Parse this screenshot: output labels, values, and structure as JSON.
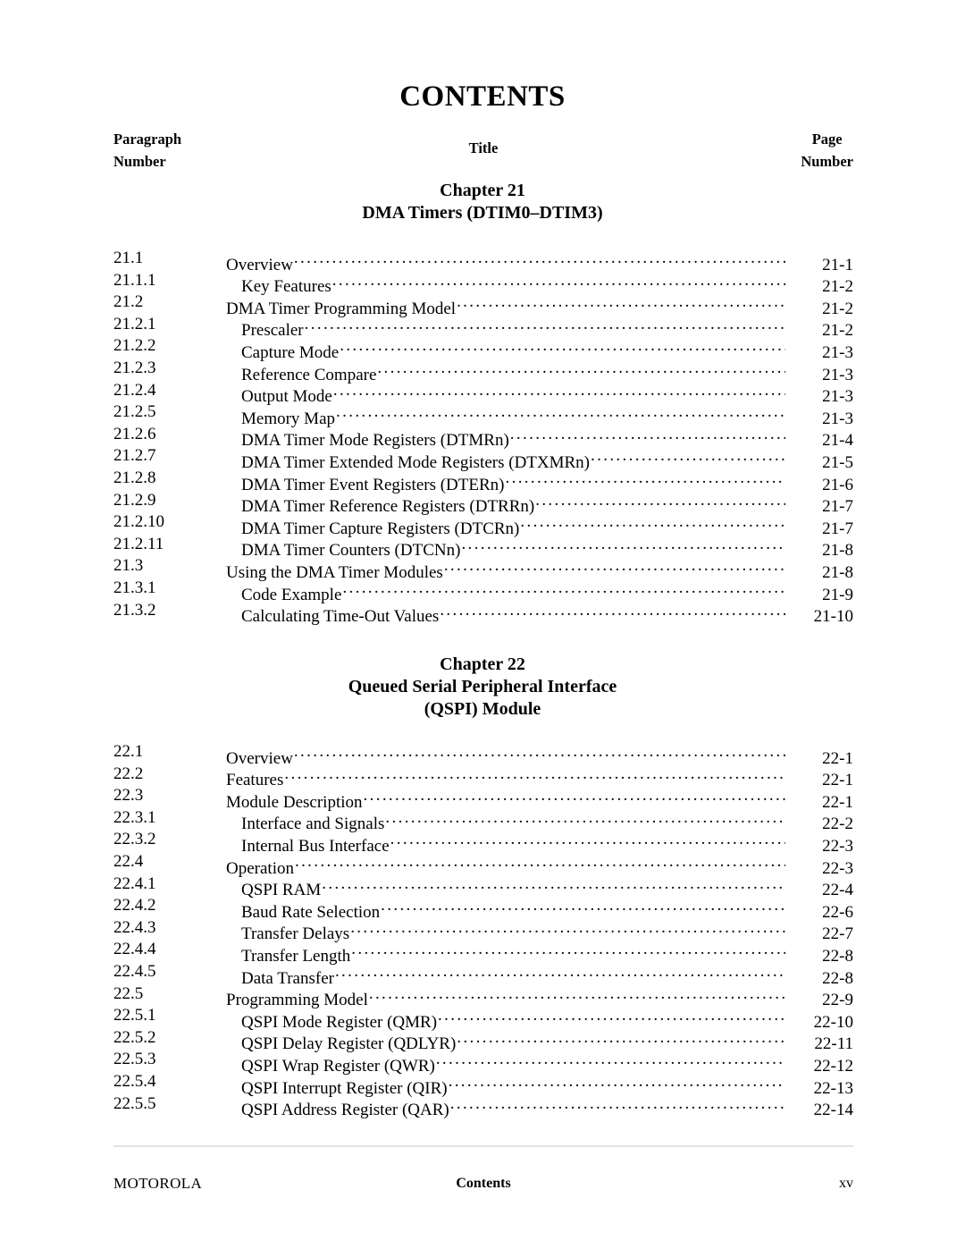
{
  "page": {
    "title": "CONTENTS",
    "headers": {
      "paragraph_line1": "Paragraph",
      "paragraph_line2": "Number",
      "title": "Title",
      "page_line1": "Page",
      "page_line2": "Number"
    }
  },
  "chapters": [
    {
      "heading_lines": [
        "Chapter 21",
        "DMA Timers (DTIM0–DTIM3)"
      ],
      "entries": [
        {
          "number": "21.1",
          "title": "Overview",
          "page": "21-1",
          "level": 1
        },
        {
          "number": "21.1.1",
          "title": "Key Features",
          "page": "21-2",
          "level": 2
        },
        {
          "number": "21.2",
          "title": "DMA Timer Programming Model",
          "page": "21-2",
          "level": 1
        },
        {
          "number": "21.2.1",
          "title": "Prescaler",
          "page": "21-2",
          "level": 2
        },
        {
          "number": "21.2.2",
          "title": "Capture Mode",
          "page": "21-3",
          "level": 2
        },
        {
          "number": "21.2.3",
          "title": "Reference Compare",
          "page": "21-3",
          "level": 2
        },
        {
          "number": "21.2.4",
          "title": "Output Mode",
          "page": "21-3",
          "level": 2
        },
        {
          "number": "21.2.5",
          "title": "Memory Map",
          "page": "21-3",
          "level": 2
        },
        {
          "number": "21.2.6",
          "title": "DMA Timer Mode Registers (DTMRn)",
          "page": "21-4",
          "level": 2
        },
        {
          "number": "21.2.7",
          "title": "DMA Timer Extended Mode Registers (DTXMRn)",
          "page": "21-5",
          "level": 2
        },
        {
          "number": "21.2.8",
          "title": "DMA Timer Event Registers (DTERn)",
          "page": "21-6",
          "level": 2
        },
        {
          "number": "21.2.9",
          "title": "DMA Timer Reference Registers (DTRRn)",
          "page": "21-7",
          "level": 2
        },
        {
          "number": "21.2.10",
          "title": "DMA Timer Capture Registers (DTCRn)",
          "page": "21-7",
          "level": 2
        },
        {
          "number": "21.2.11",
          "title": "DMA Timer Counters (DTCNn)",
          "page": "21-8",
          "level": 2
        },
        {
          "number": "21.3",
          "title": "Using the DMA Timer Modules",
          "page": "21-8",
          "level": 1
        },
        {
          "number": "21.3.1",
          "title": "Code Example",
          "page": "21-9",
          "level": 2
        },
        {
          "number": "21.3.2",
          "title": "Calculating Time-Out Values",
          "page": "21-10",
          "level": 2
        }
      ]
    },
    {
      "heading_lines": [
        "Chapter 22",
        "Queued Serial Peripheral Interface",
        "(QSPI) Module"
      ],
      "entries": [
        {
          "number": "22.1",
          "title": "Overview",
          "page": "22-1",
          "level": 1
        },
        {
          "number": "22.2",
          "title": "Features",
          "page": "22-1",
          "level": 1
        },
        {
          "number": "22.3",
          "title": "Module Description",
          "page": "22-1",
          "level": 1
        },
        {
          "number": "22.3.1",
          "title": "Interface and Signals",
          "page": "22-2",
          "level": 2
        },
        {
          "number": "22.3.2",
          "title": "Internal Bus Interface",
          "page": "22-3",
          "level": 2
        },
        {
          "number": "22.4",
          "title": "Operation",
          "page": "22-3",
          "level": 1
        },
        {
          "number": "22.4.1",
          "title": "QSPI RAM",
          "page": "22-4",
          "level": 2
        },
        {
          "number": "22.4.2",
          "title": "Baud Rate Selection",
          "page": "22-6",
          "level": 2
        },
        {
          "number": "22.4.3",
          "title": "Transfer Delays",
          "page": "22-7",
          "level": 2
        },
        {
          "number": "22.4.4",
          "title": "Transfer Length",
          "page": "22-8",
          "level": 2
        },
        {
          "number": "22.4.5",
          "title": "Data Transfer",
          "page": "22-8",
          "level": 2
        },
        {
          "number": "22.5",
          "title": "Programming Model",
          "page": "22-9",
          "level": 1
        },
        {
          "number": "22.5.1",
          "title": "QSPI Mode Register (QMR)",
          "page": "22-10",
          "level": 2
        },
        {
          "number": "22.5.2",
          "title": "QSPI Delay Register (QDLYR)",
          "page": "22-11",
          "level": 2
        },
        {
          "number": "22.5.3",
          "title": "QSPI Wrap Register (QWR)",
          "page": "22-12",
          "level": 2
        },
        {
          "number": "22.5.4",
          "title": "QSPI Interrupt Register (QIR)",
          "page": "22-13",
          "level": 2
        },
        {
          "number": "22.5.5",
          "title": "QSPI Address Register (QAR)",
          "page": "22-14",
          "level": 2
        }
      ]
    }
  ],
  "footer": {
    "left": "MOTOROLA",
    "center": "Contents",
    "right": "xv"
  }
}
